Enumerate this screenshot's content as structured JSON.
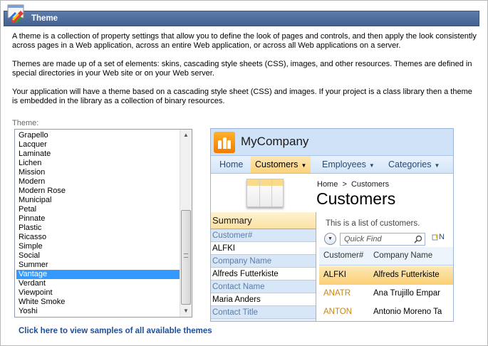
{
  "header": {
    "title": "Theme",
    "icon": "theme-palette-icon"
  },
  "paragraphs": [
    "A theme is a collection of property settings that allow you to define the look of pages and controls, and then apply the look consistently across pages in a Web application, across an entire Web application, or across all Web applications on a server.",
    "Themes are made up of a set of elements: skins, cascading style sheets (CSS), images, and other resources. Themes are defined in special directories in your Web site or on your Web server.",
    "Your application will have a theme based on a cascading style sheet (CSS) and images. If your project is a class library then a theme is embedded in the library as a collection of binary resources."
  ],
  "theme_label": "Theme:",
  "theme_list": {
    "items": [
      "Grapello",
      "Lacquer",
      "Laminate",
      "Lichen",
      "Mission",
      "Modern",
      "Modern Rose",
      "Municipal",
      "Petal",
      "Pinnate",
      "Plastic",
      "Ricasso",
      "Simple",
      "Social",
      "Summer",
      "Vantage",
      "Verdant",
      "Viewpoint",
      "White Smoke",
      "Yoshi"
    ],
    "selected": "Vantage"
  },
  "samples_link": "Click here to view samples of all available themes",
  "preview": {
    "company": "MyCompany",
    "menu": [
      {
        "label": "Home",
        "active": false,
        "dropdown": false
      },
      {
        "label": "Customers",
        "active": true,
        "dropdown": true
      },
      {
        "label": "Employees",
        "active": false,
        "dropdown": true
      },
      {
        "label": "Categories",
        "active": false,
        "dropdown": true
      }
    ],
    "breadcrumb": "Home  >  Customers",
    "heading": "Customers",
    "summary_title": "Summary",
    "summary_fields": [
      {
        "label": "Customer#",
        "value": "ALFKI"
      },
      {
        "label": "Company Name",
        "value": "Alfreds Futterkiste"
      },
      {
        "label": "Contact Name",
        "value": "Maria Anders"
      },
      {
        "label": "Contact Title",
        "value": ""
      }
    ],
    "description": "This is a list of customers.",
    "search_placeholder": "Quick Find",
    "new_label": "N",
    "grid_headers": [
      "Customer#",
      "Company Name"
    ],
    "grid_rows": [
      {
        "id": "ALFKI",
        "name": "Alfreds Futterkiste",
        "selected": true
      },
      {
        "id": "ANATR",
        "name": "Ana Trujillo Empar",
        "selected": false
      },
      {
        "id": "ANTON",
        "name": "Antonio Moreno Ta",
        "selected": false
      }
    ]
  }
}
